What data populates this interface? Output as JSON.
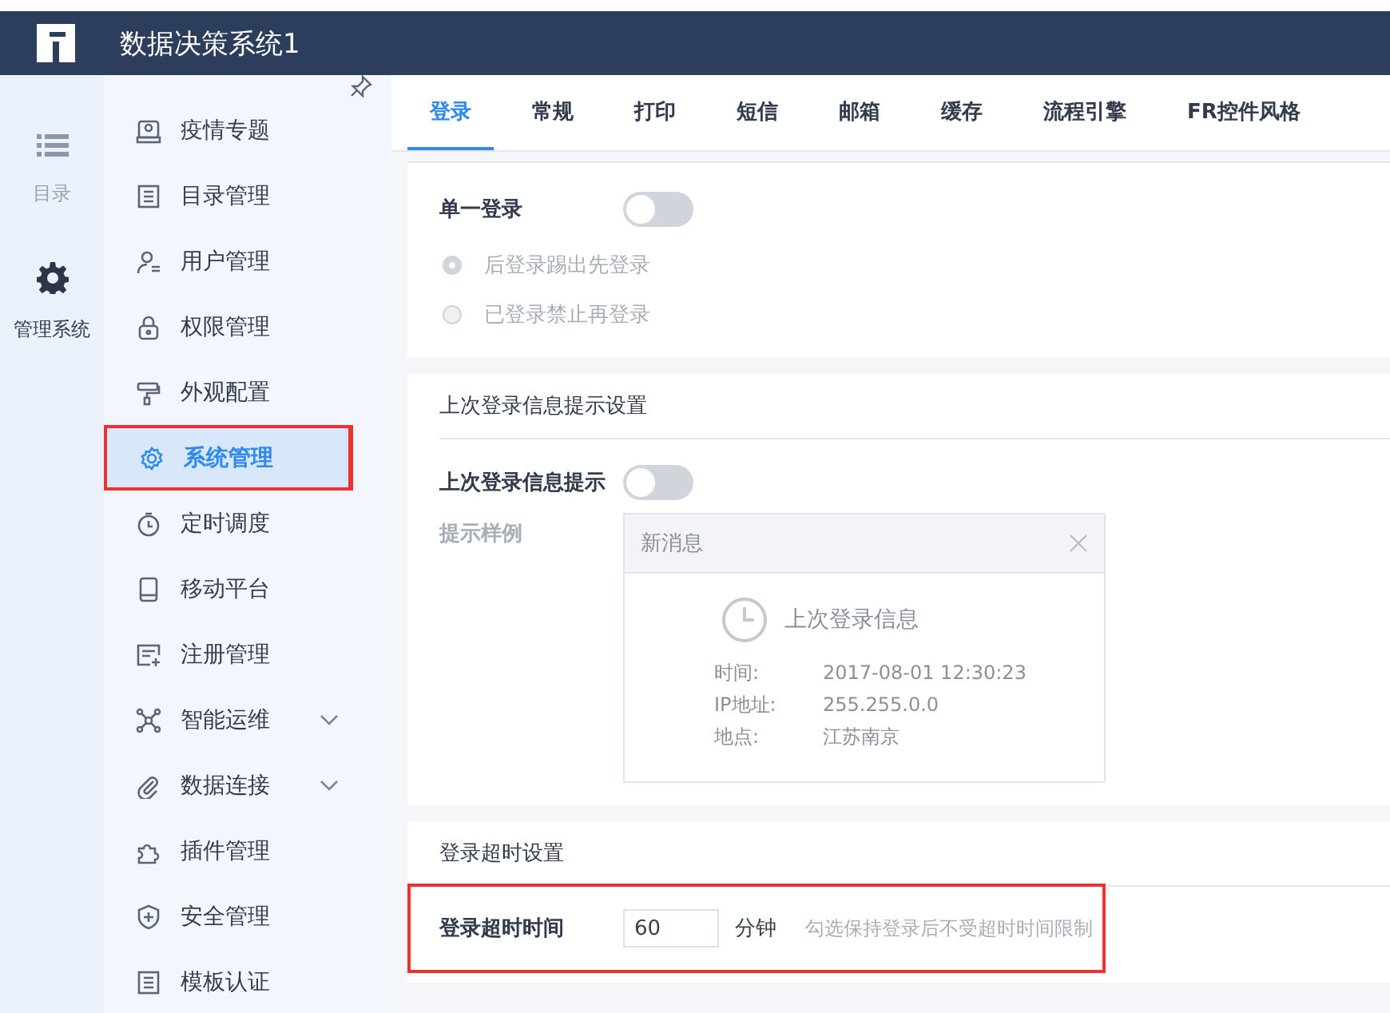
{
  "app": {
    "title": "数据决策系统1"
  },
  "rail": [
    {
      "label": "目录",
      "kind": "list",
      "selected": false
    },
    {
      "label": "管理系统",
      "kind": "gear",
      "selected": true
    }
  ],
  "menu": [
    {
      "label": "疫情专题",
      "selected": false,
      "annotated": false
    },
    {
      "label": "目录管理",
      "selected": false,
      "annotated": false
    },
    {
      "label": "用户管理",
      "selected": false,
      "annotated": false
    },
    {
      "label": "权限管理",
      "selected": false,
      "annotated": false
    },
    {
      "label": "外观配置",
      "selected": false,
      "annotated": false
    },
    {
      "label": "系统管理",
      "selected": true,
      "annotated": true
    },
    {
      "label": "定时调度",
      "selected": false,
      "annotated": false
    },
    {
      "label": "移动平台",
      "selected": false,
      "annotated": false
    },
    {
      "label": "注册管理",
      "selected": false,
      "annotated": false
    },
    {
      "label": "智能运维",
      "selected": false,
      "annotated": false,
      "expandable": true
    },
    {
      "label": "数据连接",
      "selected": false,
      "annotated": false,
      "expandable": true
    },
    {
      "label": "插件管理",
      "selected": false,
      "annotated": false
    },
    {
      "label": "安全管理",
      "selected": false,
      "annotated": false
    },
    {
      "label": "模板认证",
      "selected": false,
      "annotated": false
    }
  ],
  "tabs": [
    {
      "label": "登录",
      "selected": true
    },
    {
      "label": "常规",
      "selected": false
    },
    {
      "label": "打印",
      "selected": false
    },
    {
      "label": "短信",
      "selected": false
    },
    {
      "label": "邮箱",
      "selected": false
    },
    {
      "label": "缓存",
      "selected": false
    },
    {
      "label": "流程引擎",
      "selected": false
    },
    {
      "label": "FR控件风格",
      "selected": false
    }
  ],
  "single_login": {
    "label": "单一登录",
    "on": false,
    "options": [
      {
        "label": "后登录踢出先登录",
        "selected": true,
        "disabled": true
      },
      {
        "label": "已登录禁止再登录",
        "selected": false,
        "disabled": true
      }
    ]
  },
  "last_login": {
    "heading": "上次登录信息提示设置",
    "toggle_label": "上次登录信息提示",
    "on": false,
    "sample_label": "提示样例",
    "sample": {
      "title": "新消息",
      "headline": "上次登录信息",
      "rows": [
        {
          "key": "时间:",
          "value": "2017-08-01 12:30:23"
        },
        {
          "key": "IP地址:",
          "value": "255.255.0.0"
        },
        {
          "key": "地点:",
          "value": "江苏南京"
        }
      ]
    }
  },
  "timeout": {
    "heading": "登录超时设置",
    "label": "登录超时时间",
    "value": "60",
    "unit": "分钟",
    "hint": "勾选保持登录后不受超时时间限制",
    "annotated": true
  }
}
